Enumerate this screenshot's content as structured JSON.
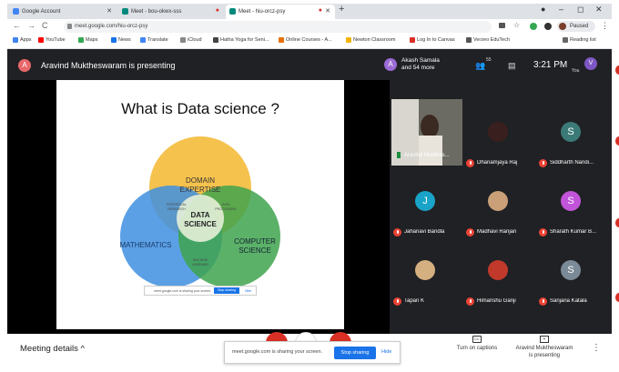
{
  "browser": {
    "tabs": [
      {
        "label": "Google Account"
      },
      {
        "label": "Meet - bou-okwx-sss"
      },
      {
        "label": "Meet - hiu-orcz-psy"
      }
    ],
    "url": "meet.google.com/hiu-orcz-psy",
    "profile_status": "Paused",
    "bookmarks": [
      {
        "label": "Apps",
        "color": "#4285f4"
      },
      {
        "label": "YouTube",
        "color": "#ff0000"
      },
      {
        "label": "Maps",
        "color": "#34a853"
      },
      {
        "label": "News",
        "color": "#1a73e8"
      },
      {
        "label": "Translate",
        "color": "#4285f4"
      },
      {
        "label": "iCloud",
        "color": "#888888"
      },
      {
        "label": "Hatha Yoga for Seni...",
        "color": "#444444"
      },
      {
        "label": "Online Courses - A...",
        "color": "#e8710a"
      },
      {
        "label": "Newton Classroom",
        "color": "#f4b400"
      },
      {
        "label": "Log In to Canvas",
        "color": "#d93025"
      },
      {
        "label": "Verzeo EduTech",
        "color": "#555555"
      }
    ],
    "reading_list": "Reading list"
  },
  "meet": {
    "presenter": {
      "initial": "A",
      "text": "Aravind Muktheswaram is presenting",
      "color": "#e8686a"
    },
    "participants_header": {
      "initial": "A",
      "name": "Akash Samala",
      "more": "and 54 more",
      "count": "55"
    },
    "time": "3:21 PM",
    "you_label": "You",
    "you_initial": "V",
    "slide": {
      "title": "What is Data science ?",
      "circles": {
        "top": "DOMAIN\nEXPERTISE",
        "left": "MATHEMATICS",
        "right": "COMPUTER\nSCIENCE",
        "center": "DATA\nSCIENCE",
        "overlap_top_left": "STATISTICAL\nRESEARCH",
        "overlap_top_right": "DATA\nPROCESSING",
        "overlap_bottom": "MACHINE\nLEARNING"
      },
      "mini_share_text": "meet.google.com is sharing your screen.",
      "mini_stop": "Stop sharing",
      "mini_hide": "Hide"
    },
    "tiles": [
      {
        "name": "Aravind Mukthes...",
        "kind": "video"
      },
      {
        "name": "Dhanamjaya Raj",
        "kind": "photo",
        "color": "#3a1f1f"
      },
      {
        "name": "Siddharth Nandi...",
        "kind": "letter",
        "initial": "S",
        "color": "#3c7a78"
      },
      {
        "name": "Jahanavi Bandla",
        "kind": "letter",
        "initial": "J",
        "color": "#1aa3c8"
      },
      {
        "name": "Madhavi Ranjan",
        "kind": "photo",
        "color": "#c9a078"
      },
      {
        "name": "Sharath Kumar B...",
        "kind": "letter",
        "initial": "S",
        "color": "#c254d9"
      },
      {
        "name": "Tapan K",
        "kind": "photo",
        "color": "#d4b080"
      },
      {
        "name": "Himanshu Ganji",
        "kind": "photo",
        "color": "#c0392b"
      },
      {
        "name": "Sanjana Katala",
        "kind": "letter",
        "initial": "S",
        "color": "#7a8a96"
      }
    ]
  },
  "bottom": {
    "meeting_details": "Meeting details",
    "share_text": "meet.google.com is sharing your screen.",
    "stop_sharing": "Stop sharing",
    "hide": "Hide",
    "captions": "Turn on captions",
    "presenting": "Aravind Muktheswaram\nis presenting"
  }
}
